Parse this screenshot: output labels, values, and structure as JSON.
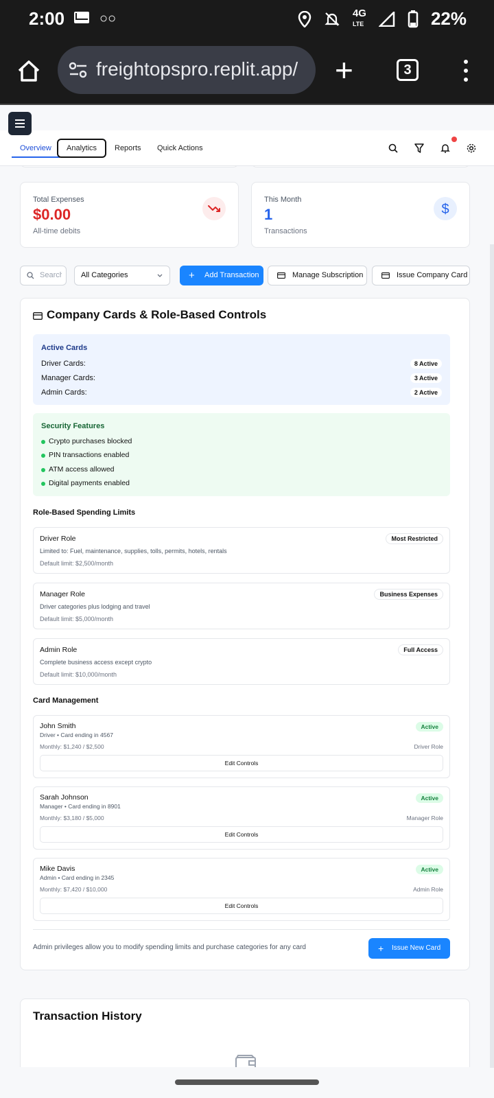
{
  "status_bar": {
    "time": "2:00",
    "battery": "22%",
    "network": "4G LTE"
  },
  "browser": {
    "url": "freightopspro.replit.app/",
    "tab_count": "3"
  },
  "nav": {
    "tabs": [
      "Overview",
      "Analytics",
      "Reports",
      "Quick Actions"
    ]
  },
  "stats": {
    "expenses": {
      "label": "Total Expenses",
      "value": "$0.00",
      "sub": "All-time debits",
      "color": "#dc2626"
    },
    "month": {
      "label": "This Month",
      "value": "1",
      "sub": "Transactions",
      "color": "#2563eb"
    }
  },
  "toolbar": {
    "search_placeholder": "Search",
    "category_select": "All Categories",
    "add_transaction": "Add Transaction",
    "manage_subscription": "Manage Subscription",
    "issue_company_card": "Issue Company Card"
  },
  "company_cards": {
    "title": "Company Cards & Role-Based Controls",
    "active": {
      "heading": "Active Cards",
      "rows": [
        {
          "label": "Driver Cards:",
          "value": "8 Active"
        },
        {
          "label": "Manager Cards:",
          "value": "3 Active"
        },
        {
          "label": "Admin Cards:",
          "value": "2 Active"
        }
      ]
    },
    "security": {
      "heading": "Security Features",
      "items": [
        "Crypto purchases blocked",
        "PIN transactions enabled",
        "ATM access allowed",
        "Digital payments enabled"
      ]
    },
    "limits_heading": "Role-Based Spending Limits",
    "roles": [
      {
        "name": "Driver Role",
        "badge": "Most Restricted",
        "desc": "Limited to: Fuel, maintenance, supplies, tolls, permits, hotels, rentals",
        "limit": "Default limit: $2,500/month"
      },
      {
        "name": "Manager Role",
        "badge": "Business Expenses",
        "desc": "Driver categories plus lodging and travel",
        "limit": "Default limit: $5,000/month"
      },
      {
        "name": "Admin Role",
        "badge": "Full Access",
        "desc": "Complete business access except crypto",
        "limit": "Default limit: $10,000/month"
      }
    ],
    "management_heading": "Card Management",
    "cards": [
      {
        "name": "John Smith",
        "status": "Active",
        "sub": "Driver • Card ending in 4567",
        "monthly": "Monthly: $1,240 / $2,500",
        "role": "Driver Role",
        "edit": "Edit Controls"
      },
      {
        "name": "Sarah Johnson",
        "status": "Active",
        "sub": "Manager • Card ending in 8901",
        "monthly": "Monthly: $3,180 / $5,000",
        "role": "Manager Role",
        "edit": "Edit Controls"
      },
      {
        "name": "Mike Davis",
        "status": "Active",
        "sub": "Admin • Card ending in 2345",
        "monthly": "Monthly: $7,420 / $10,000",
        "role": "Admin Role",
        "edit": "Edit Controls"
      }
    ],
    "admin_note": "Admin privileges allow you to modify spending limits and purchase categories for any card",
    "issue_new_card": "Issue New Card"
  },
  "transaction_history": {
    "title": "Transaction History"
  }
}
